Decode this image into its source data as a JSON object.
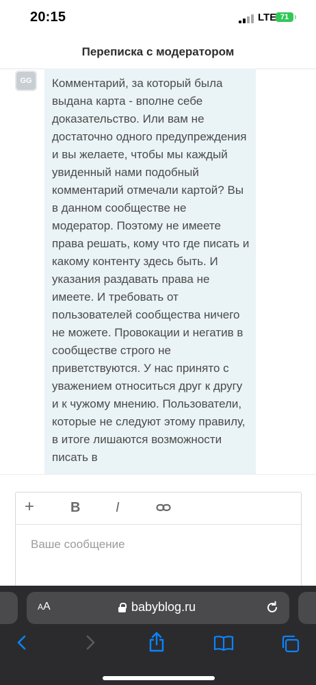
{
  "status_bar": {
    "time": "20:15",
    "network": "LTE",
    "battery": "71"
  },
  "header": {
    "title": "Переписка с модератором"
  },
  "message": {
    "avatar_text": "GG",
    "text": "Комментарий, за который была выдана карта - вполне себе доказательство. Или вам не достаточно одного предупреждения и вы желаете, чтобы мы каждый увиденный нами подобный комментарий отмечали картой? Вы в данном сообществе не модератор. Поэтому не имеете права решать, кому что где писать и какому контенту здесь быть. И указания раздавать права не имеете. И требовать от пользователей сообщества ничего не можете. Провокации и негатив в сообществе строго не приветствуются. У нас принято с уважением относиться друг к другу и к чужому мнению. Пользователи, которые не следуют этому правилу, в итоге лишаются возможности писать в"
  },
  "composer": {
    "toolbar": {
      "add_label": "+",
      "bold_label": "B",
      "italic_label": "I",
      "link_icon": "link-icon"
    },
    "placeholder": "Ваше сообщение"
  },
  "browser": {
    "text_size_small": "A",
    "text_size_large": "A",
    "url": "babyblog.ru",
    "icons": [
      "back-icon",
      "forward-icon",
      "share-icon",
      "bookmarks-icon",
      "tabs-icon"
    ]
  },
  "colors": {
    "bubble_bg": "#eaf3f6",
    "accent_blue": "#0a84ff",
    "battery_green": "#32c759",
    "safari_bg": "#2b2b2d"
  }
}
